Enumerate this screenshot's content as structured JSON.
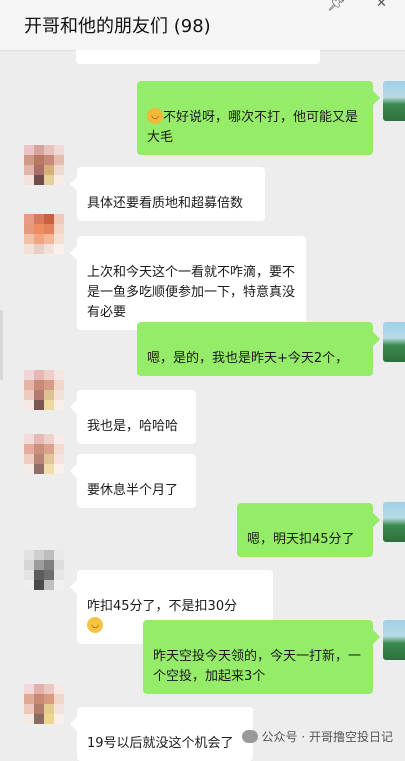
{
  "header": {
    "title": "开哥和他的朋友们 (98)",
    "pin_icon": "pin-icon",
    "close_icon": "close-icon"
  },
  "messages": [
    {
      "side": "right",
      "text": "不好说呀，哪次不打，他可能又是大毛",
      "emoji": "laughing-tears"
    },
    {
      "side": "left",
      "text": "具体还要看质地和超募倍数"
    },
    {
      "side": "left",
      "text": "上次和今天这个一看就不咋滴，要不是一鱼多吃顺便参加一下，特意真没有必要"
    },
    {
      "side": "right",
      "text": "嗯，是的，我也是昨天+今天2个，"
    },
    {
      "side": "left",
      "text": "我也是，哈哈哈"
    },
    {
      "side": "left",
      "text": "要休息半个月了"
    },
    {
      "side": "right",
      "text": "嗯，明天扣45分了"
    },
    {
      "side": "left",
      "text": "咋扣45分了，不是扣30分",
      "emoji": "grin"
    },
    {
      "side": "right",
      "text": "昨天空投今天领的，今天一打新，一个空投，加起来3个"
    },
    {
      "side": "left",
      "text": "19号以后就没这个机会了"
    }
  ],
  "watermark": "公众号 · 开哥撸空投日记",
  "colors": {
    "bubble_self": "#95ec69",
    "bubble_other": "#ffffff",
    "background": "#ededed"
  }
}
